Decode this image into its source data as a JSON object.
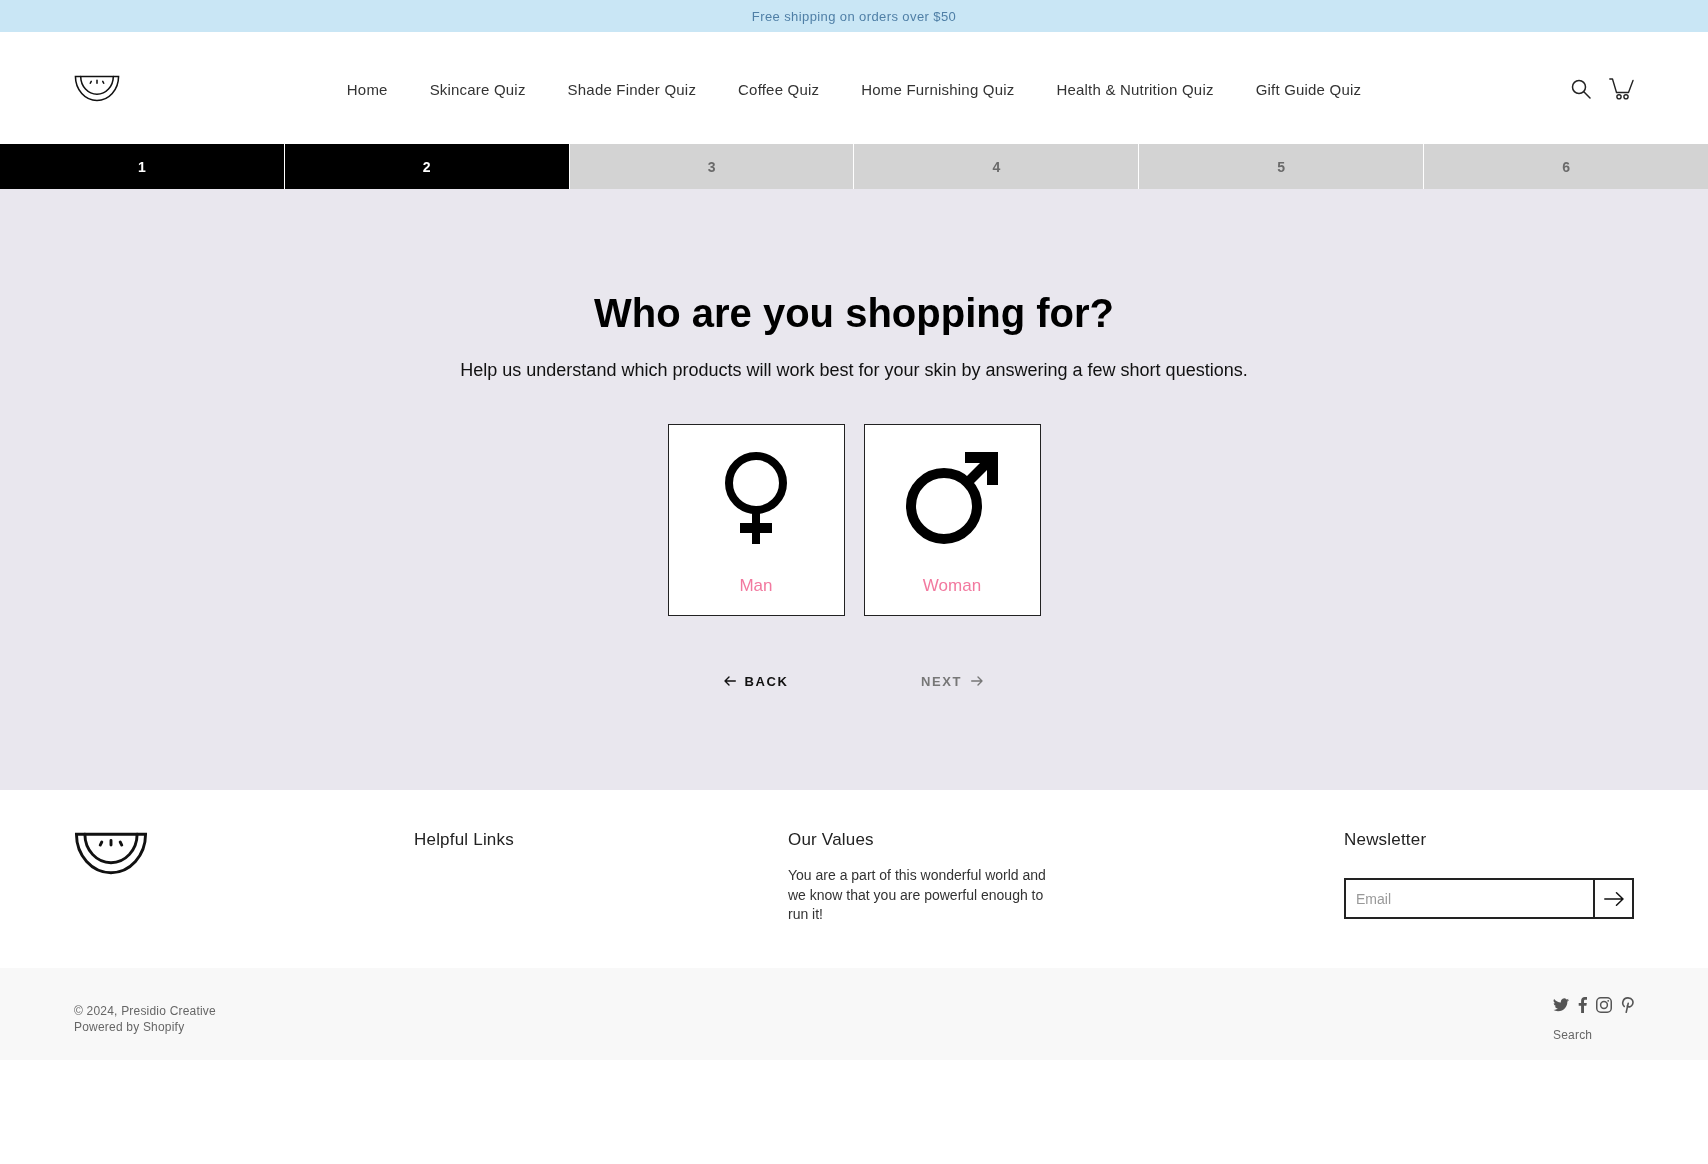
{
  "announcement_bar": {
    "text": "Free shipping on orders over $50"
  },
  "header": {
    "nav": [
      "Home",
      "Skincare Quiz",
      "Shade Finder Quiz",
      "Coffee Quiz",
      "Home Furnishing Quiz",
      "Health & Nutrition Quiz",
      "Gift Guide Quiz"
    ]
  },
  "progress": {
    "steps": [
      {
        "label": "1",
        "done": true
      },
      {
        "label": "2",
        "done": true
      },
      {
        "label": "3",
        "done": false
      },
      {
        "label": "4",
        "done": false
      },
      {
        "label": "5",
        "done": false
      },
      {
        "label": "6",
        "done": false
      }
    ]
  },
  "quiz": {
    "title": "Who are you shopping for?",
    "subtitle": "Help us understand which products will work best for your skin by answering a few short questions.",
    "options": [
      {
        "label": "Man",
        "kind": "female",
        "selected": false
      },
      {
        "label": "Woman",
        "kind": "male",
        "selected": false
      }
    ],
    "buttons": [
      {
        "label": "BACK",
        "kind": "back",
        "disabled": false
      },
      {
        "label": "NEXT",
        "kind": "next",
        "disabled": true
      }
    ]
  },
  "footer": {
    "columns": [
      {
        "heading": "Helpful Links"
      },
      {
        "heading": "Our Values",
        "text": "You are a part of this wonderful world and we know that you are powerful enough to run it!"
      }
    ],
    "newsletter": {
      "heading": "Newsletter",
      "placeholder": "Email"
    }
  },
  "bottom_bar": {
    "copyright": "© 2024, Presidio Creative",
    "powered_by": "Powered by Shopify",
    "links": [
      "Search"
    ]
  }
}
